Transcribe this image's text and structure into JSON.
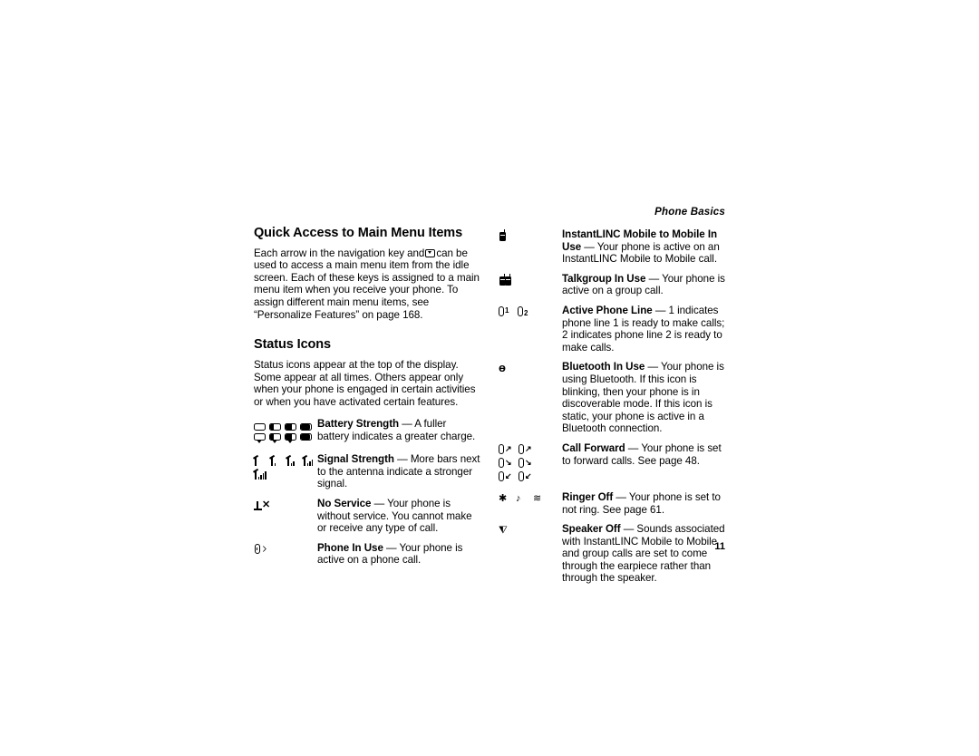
{
  "header": {
    "running_head": "Phone Basics"
  },
  "footer": {
    "page_number": "11"
  },
  "left_column": {
    "section1": {
      "heading": "Quick Access to Main Menu Items",
      "paragraph_before_icon": "Each arrow in the navigation key and",
      "inline_icon": "nav-key-icon",
      "paragraph_after_icon": "can be used to access a main menu item from the idle screen. Each of these keys is assigned to a main menu item when you receive your phone. To assign different main menu items, see “Personalize Features” on page 168."
    },
    "section2": {
      "heading": "Status Icons",
      "intro": "Status icons appear at the top of the display. Some appear at all times. Others appear only when your phone is engaged in certain activities or when you have activated certain features."
    },
    "entries": [
      {
        "icon_name": "battery-strength-icon",
        "term": "Battery Strength",
        "dash": "—",
        "description": "A fuller battery indicates a greater charge."
      },
      {
        "icon_name": "signal-strength-icon",
        "term": "Signal Strength",
        "dash": "—",
        "description": "More bars next to the antenna indicate a stronger signal."
      },
      {
        "icon_name": "no-service-icon",
        "term": "No Service",
        "dash": "—",
        "description": "Your phone is without service. You cannot make or receive any type of call."
      },
      {
        "icon_name": "phone-in-use-icon",
        "term": "Phone In Use",
        "dash": "—",
        "description": "Your phone is active on a phone call."
      }
    ]
  },
  "right_column": {
    "entries": [
      {
        "icon_name": "instantlinc-mobile-icon",
        "term": "InstantLINC Mobile to Mobile In Use",
        "dash": "—",
        "description": "Your phone is active on an InstantLINC Mobile to Mobile call."
      },
      {
        "icon_name": "talkgroup-in-use-icon",
        "term": "Talkgroup In Use",
        "dash": "—",
        "description": "Your phone is active on a group call."
      },
      {
        "icon_name": "active-phone-line-icon",
        "term": "Active Phone Line",
        "dash": "—",
        "description": "1 indicates phone line 1 is ready to make calls; 2 indicates phone line 2 is ready to make calls."
      },
      {
        "icon_name": "bluetooth-in-use-icon",
        "term": "Bluetooth In Use",
        "dash": "—",
        "description": "Your phone is using Bluetooth. If this icon is blinking, then your phone is in discoverable mode. If this icon is static, your phone is active in a Bluetooth connection."
      },
      {
        "icon_name": "call-forward-icon",
        "term": "Call Forward",
        "dash": "—",
        "description": "Your phone is set to forward calls. See page 48."
      },
      {
        "icon_name": "ringer-off-icon",
        "term": "Ringer Off",
        "dash": "—",
        "description": "Your phone is set to not ring. See page 61."
      },
      {
        "icon_name": "speaker-off-icon",
        "term": "Speaker Off",
        "dash": "—",
        "description": "Sounds associated with InstantLINC Mobile to Mobile and group calls are set to come through the earpiece rather than through the speaker."
      }
    ]
  },
  "glyphs": {
    "bluetooth_symbol": "ɵ",
    "ringer_bell": "✱",
    "ringer_note": "♪",
    "ringer_vibe": "≋",
    "speaker": "⧨",
    "arrow": "↱"
  }
}
